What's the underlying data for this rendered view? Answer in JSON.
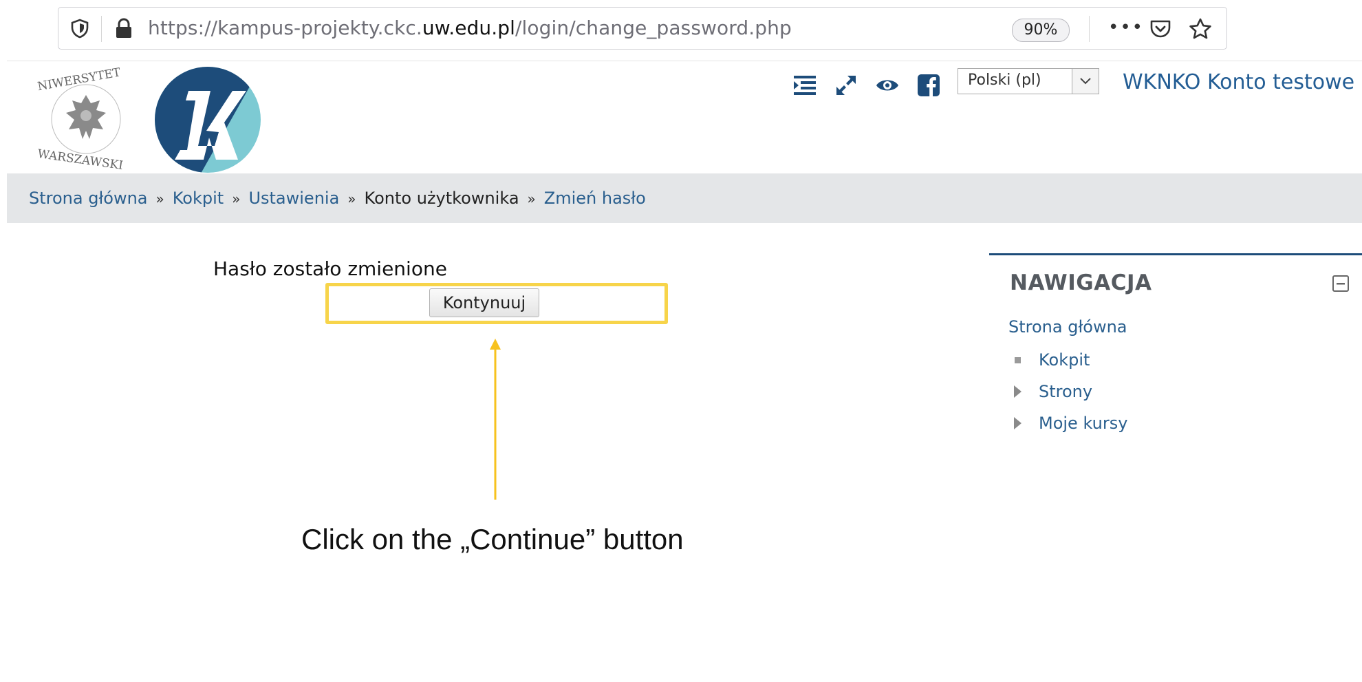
{
  "browser": {
    "url_prefix": "https://kampus-projekty.ckc.",
    "url_domain": "uw.edu.pl",
    "url_path": "/login/change_password.php",
    "zoom": "90%",
    "overflow_menu": "•••"
  },
  "header": {
    "language": "Polski (pl)",
    "user_name": "WKNKO Konto testowe"
  },
  "breadcrumb": {
    "separator": "»",
    "items": [
      {
        "label": "Strona główna"
      },
      {
        "label": "Kokpit"
      },
      {
        "label": "Ustawienia"
      },
      {
        "label": "Konto użytkownika"
      },
      {
        "label": "Zmień hasło"
      }
    ]
  },
  "main": {
    "notice": "Hasło zostało zmienione",
    "continue_label": "Kontynuuj",
    "instruction": "Click on the „Continue” button"
  },
  "navigation": {
    "title": "NAWIGACJA",
    "home": "Strona główna",
    "items": [
      {
        "label": "Kokpit"
      },
      {
        "label": "Strony"
      },
      {
        "label": "Moje kursy"
      }
    ]
  },
  "colors": {
    "link": "#2a5f8e",
    "highlight": "#f7d44a",
    "brand_dark": "#1d4c7a",
    "brand_teal": "#7dcad3"
  }
}
